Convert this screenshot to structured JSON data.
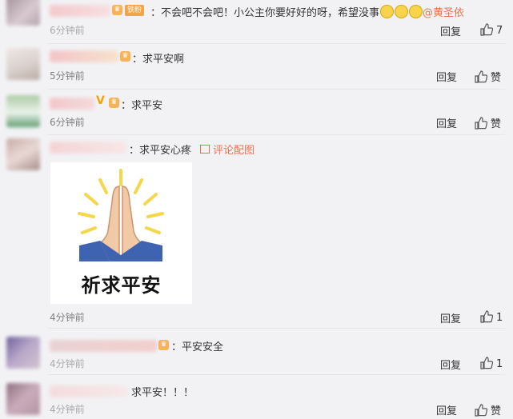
{
  "comments": [
    {
      "text": "：不会吧不会吧！小公主你要好好的呀，希望没事",
      "mention": "@黄圣依",
      "fan_label": "铁粉",
      "time": "6分钟前",
      "reply": "回复",
      "likes": "7"
    },
    {
      "text": "：求平安啊",
      "time": "5分钟前",
      "reply": "回复",
      "likes": "赞"
    },
    {
      "text": "：求平安",
      "time": "6分钟前",
      "reply": "回复",
      "likes": "赞"
    },
    {
      "text": "：求平安心疼",
      "pic_link": "评论配图",
      "image_caption": "祈求平安",
      "time": "4分钟前",
      "reply": "回复",
      "likes": "1"
    },
    {
      "text": "：平安安全",
      "time": "4分钟前",
      "reply": "回复",
      "likes": "1"
    },
    {
      "text": "求平安！！！",
      "time": "4分钟前",
      "reply": "回复",
      "likes": "赞"
    }
  ],
  "colors": {
    "accent": "#eb7350",
    "badge": "#f3a447",
    "verified": "#f2a400",
    "emoji": "#f9d34a",
    "prayer_hands": "#f1c9a5",
    "prayer_sleeve": "#3e63b0"
  },
  "icons": {
    "like": "thumbs-up-icon",
    "emoji": "sad-face-emoji",
    "picture": "picture-icon",
    "badge": "vip-badge-icon"
  }
}
